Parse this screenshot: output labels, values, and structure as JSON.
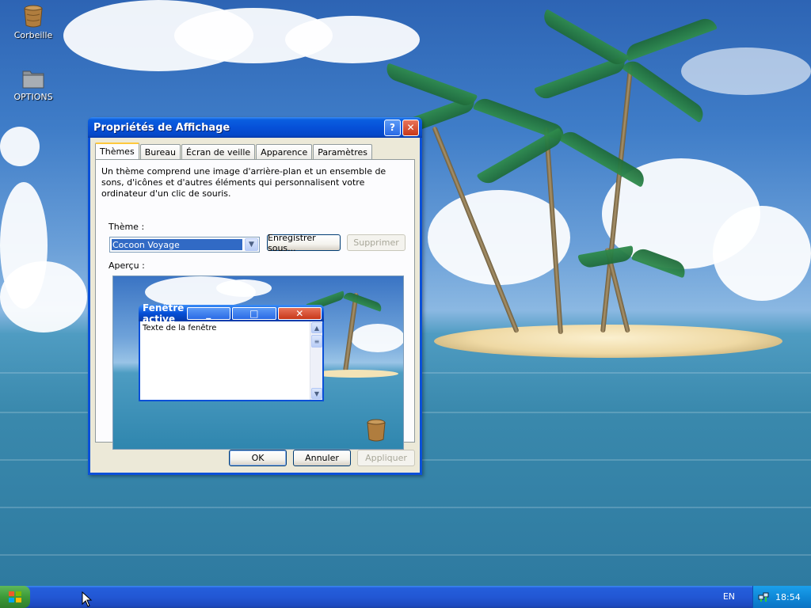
{
  "desktop": {
    "icons": [
      {
        "label": "Corbeille",
        "icon": "recycle-bin-icon"
      },
      {
        "label": "OPTIONS",
        "icon": "folder-icon"
      }
    ]
  },
  "dialog": {
    "title": "Propriétés de Affichage",
    "title_buttons": {
      "help": "?",
      "close": "✕"
    },
    "tabs": [
      "Thèmes",
      "Bureau",
      "Écran de veille",
      "Apparence",
      "Paramètres"
    ],
    "active_tab": "Thèmes",
    "description": "Un thème comprend une image d'arrière-plan et un ensemble de sons, d'icônes et d'autres éléments qui personnalisent votre ordinateur d'un clic de souris.",
    "theme_label": "Thème :",
    "theme_value": "Cocoon Voyage",
    "save_button": "Enregistrer sous...",
    "delete_button": "Supprimer",
    "preview_label": "Aperçu :",
    "preview": {
      "window_title": "Fenêtre active",
      "window_text": "Texte de la fenêtre"
    },
    "footer": {
      "ok": "OK",
      "cancel": "Annuler",
      "apply": "Appliquer"
    }
  },
  "taskbar": {
    "language": "EN",
    "clock": "18:54"
  },
  "colors": {
    "title_blue": "#0650d8",
    "dialog_face": "#ece9d8",
    "selection": "#316ac5",
    "tab_highlight": "#ffc83c"
  }
}
